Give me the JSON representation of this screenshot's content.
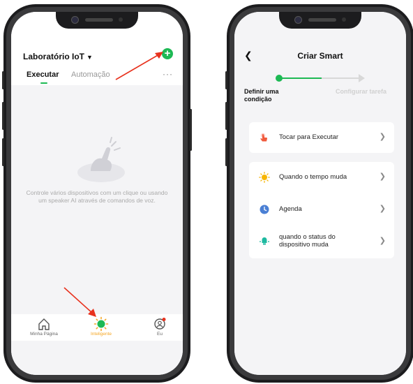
{
  "left_screen": {
    "home_title": "Laboratório IoT",
    "tabs": [
      {
        "label": "Executar",
        "active": true
      },
      {
        "label": "Automação",
        "active": false
      }
    ],
    "add_icon": "plus-circle-icon",
    "more_icon": "more-dots-icon",
    "empty_message": "Controle vários dispositivos com um clique ou usando um speaker AI através de comandos de voz.",
    "bottom_nav": [
      {
        "label": "Minha Página",
        "icon": "home-icon"
      },
      {
        "label": "Inteligente",
        "icon": "smart-sun-icon",
        "active": true
      },
      {
        "label": "Eu",
        "icon": "profile-icon"
      }
    ]
  },
  "right_screen": {
    "title": "Criar Smart",
    "steps": [
      {
        "label": "Definir uma condição",
        "active": true
      },
      {
        "label": "Configurar tarefa",
        "active": false
      }
    ],
    "card1": [
      {
        "label": "Tocar para Executar",
        "icon": "tap-hand-icon"
      }
    ],
    "card2": [
      {
        "label": "Quando o tempo muda",
        "icon": "weather-sun-icon"
      },
      {
        "label": "Agenda",
        "icon": "clock-icon"
      },
      {
        "label": "quando o status do dispositivo muda",
        "icon": "device-status-icon"
      }
    ]
  },
  "colors": {
    "accent_green": "#1db954",
    "active_nav": "#f5a623",
    "annotation_arrow": "#e8321e"
  }
}
